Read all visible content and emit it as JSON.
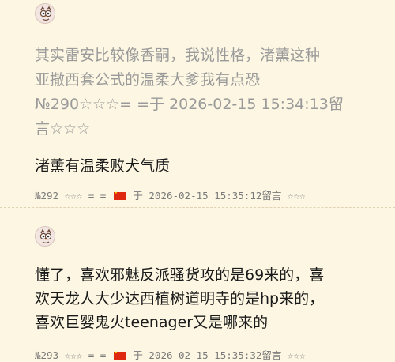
{
  "post1": {
    "quote_lines": [
      "其实雷安比较像香嗣，我说性格，渚薰这种",
      "亚撒西套公式的温柔大爹我有点恐",
      "№290☆☆☆= =于 2026-02-15 15:34:13留",
      "言☆☆☆"
    ],
    "reply": "渚薰有温柔败犬气质",
    "meta_before_flag": "№292 ☆☆☆ = =",
    "meta_after_flag": "于 2026-02-15 15:35:12留言 ☆☆☆"
  },
  "post2": {
    "lines": [
      "懂了，喜欢邪魅反派骚货攻的是69来的，喜",
      "欢天龙人大少达西植树道明寺的是hp来的，",
      "喜欢巨婴鬼火teenager又是哪来的"
    ],
    "meta_partial": "№293 ☆☆☆ = =",
    "meta_partial_after": "于 2026-02-15 15:35:32留言 ☆☆☆"
  },
  "icons": {
    "avatar": "owl-avatar-icon",
    "flag": "china-flag-icon"
  },
  "colors": {
    "background": "#fcf6e2",
    "muted_text": "#9a9a9a",
    "body_text": "#1a1a1a",
    "meta_text": "#7a7a7a"
  }
}
